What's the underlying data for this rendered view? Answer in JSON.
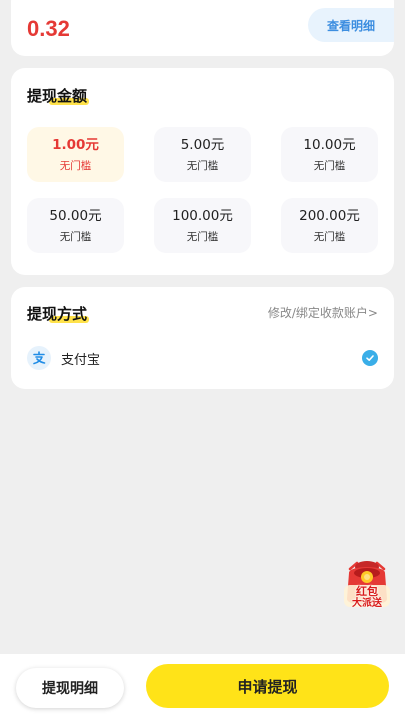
{
  "balance": {
    "amount": "0.32",
    "detail_link": "查看明细"
  },
  "amount_section": {
    "title": "提现金额",
    "options": [
      {
        "value": "1.00元",
        "note": "无门槛",
        "selected": true
      },
      {
        "value": "5.00元",
        "note": "无门槛",
        "selected": false
      },
      {
        "value": "10.00元",
        "note": "无门槛",
        "selected": false
      },
      {
        "value": "50.00元",
        "note": "无门槛",
        "selected": false
      },
      {
        "value": "100.00元",
        "note": "无门槛",
        "selected": false
      },
      {
        "value": "200.00元",
        "note": "无门槛",
        "selected": false
      }
    ]
  },
  "method_section": {
    "title": "提现方式",
    "modify_link": "修改/绑定收款账户>",
    "method_label": "支付宝",
    "method_icon": "alipay-icon",
    "selected_icon": "check-circle-icon"
  },
  "floating_badge": {
    "line1": "红包",
    "line2": "大派送",
    "icon": "red-packet-icon"
  },
  "bottom_bar": {
    "history_button": "提现明细",
    "apply_button": "申请提现"
  },
  "colors": {
    "accent_red": "#e53935",
    "accent_yellow": "#ffe318",
    "link_blue": "#3d8ee0",
    "check_blue": "#3aaee8"
  }
}
